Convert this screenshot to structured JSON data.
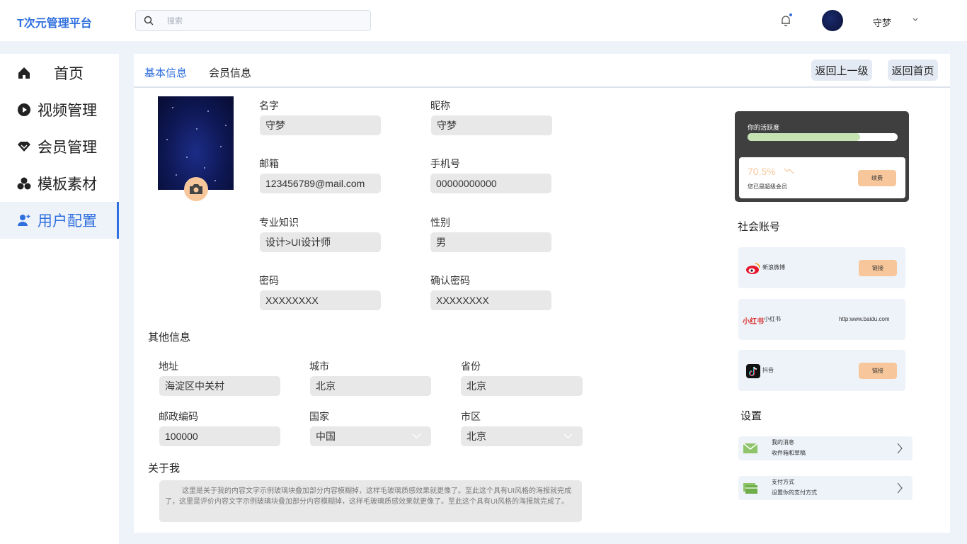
{
  "header": {
    "logo": "T次元管理平台",
    "search_placeholder": "搜索",
    "username": "守梦"
  },
  "sidebar": {
    "items": [
      {
        "label": "首页",
        "icon": "home-icon"
      },
      {
        "label": "视频管理",
        "icon": "play-icon"
      },
      {
        "label": "会员管理",
        "icon": "diamond-icon"
      },
      {
        "label": "模板素材",
        "icon": "cluster-icon"
      },
      {
        "label": "用户配置",
        "icon": "user-add-icon",
        "active": true
      }
    ]
  },
  "tabs": {
    "basic": "基本信息",
    "member": "会员信息",
    "back_label": "返回上一级",
    "home_label": "返回首页"
  },
  "profile": {
    "name_label": "名字",
    "name_value": "守梦",
    "nickname_label": "昵称",
    "nickname_value": "守梦",
    "email_label": "邮箱",
    "email_value": "123456789@mail.com",
    "phone_label": "手机号",
    "phone_value": "00000000000",
    "skill_label": "专业知识",
    "skill_value": "设计>UI设计师",
    "gender_label": "性别",
    "gender_value": "男",
    "password_label": "密码",
    "password_value": "XXXXXXXX",
    "confirm_label": "确认密码",
    "confirm_value": "XXXXXXXX"
  },
  "other": {
    "title": "其他信息",
    "address_label": "地址",
    "address_value": "海淀区中关村",
    "city_label": "城市",
    "city_value": "北京",
    "province_label": "省份",
    "province_value": "北京",
    "zip_label": "邮政编码",
    "zip_value": "100000",
    "country_label": "国家",
    "country_value": "中国",
    "district_label": "市区",
    "district_value": "北京"
  },
  "about": {
    "title": "关于我",
    "text": "这里是关于我的内容文字示例玻璃块叠加部分内容模糊掉，这样毛玻璃质感效果就更像了。至此这个具有UI风格的海报就完成了，这里是评价内容文字示例玻璃块叠加部分内容模糊掉，这样毛玻璃质感效果就更像了。至此这个具有UI风格的海报就完成了。"
  },
  "activity": {
    "title": "你的活跃度",
    "progress": 0.75,
    "percent": "70.5%",
    "member_text": "您已是超级会员",
    "renew_label": "续费"
  },
  "social": {
    "title": "社会账号",
    "accounts": [
      {
        "name": "新浪微博",
        "action": "链接",
        "icon": "weibo-icon"
      },
      {
        "name": "小红书",
        "logo": "小红书",
        "url": "http:www.baidu.com",
        "icon": "xiaohongshu-icon"
      },
      {
        "name": "抖音",
        "action": "链接",
        "icon": "douyin-icon"
      }
    ]
  },
  "settings": {
    "title": "设置",
    "items": [
      {
        "title": "我的消息",
        "subtitle": "收件箱和草稿",
        "icon": "mail-icon"
      },
      {
        "title": "支付方式",
        "subtitle": "设置你的支付方式",
        "icon": "card-icon"
      }
    ]
  },
  "colors": {
    "accent": "#2f6fde",
    "orange": "#f7c79b",
    "progress": "#c5e3b3"
  }
}
